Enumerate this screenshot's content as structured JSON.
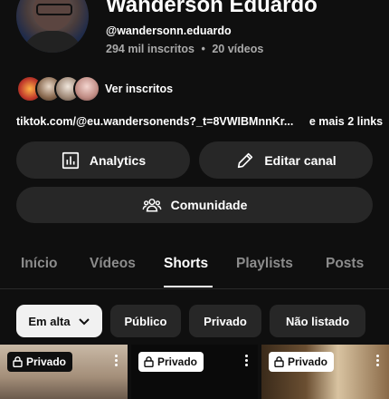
{
  "channel": {
    "name": "Wanderson Eduardo",
    "handle": "@wandersonn.eduardo",
    "subscribers": "294 mil inscritos",
    "separator": "•",
    "videos": "20 vídeos",
    "subscribers_link": "Ver inscritos",
    "link_text": "tiktok.com/@eu.wandersonends?_t=8VWIBMnnKr...",
    "more_links": "e mais 2 links"
  },
  "actions": {
    "analytics": "Analytics",
    "edit": "Editar canal",
    "community": "Comunidade"
  },
  "tabs": [
    "Início",
    "Vídeos",
    "Shorts",
    "Playlists",
    "Posts"
  ],
  "active_tab": "Shorts",
  "filters": {
    "sort": "Em alta",
    "public": "Público",
    "private": "Privado",
    "unlisted": "Não listado"
  },
  "thumbnails": [
    {
      "badge": "Privado"
    },
    {
      "badge": "Privado"
    },
    {
      "badge": "Privado"
    }
  ],
  "colors": {
    "background": "#0f0f0f",
    "button": "#272727",
    "muted_text": "#aaaaaa",
    "tab_inactive": "#8c8c8c"
  }
}
